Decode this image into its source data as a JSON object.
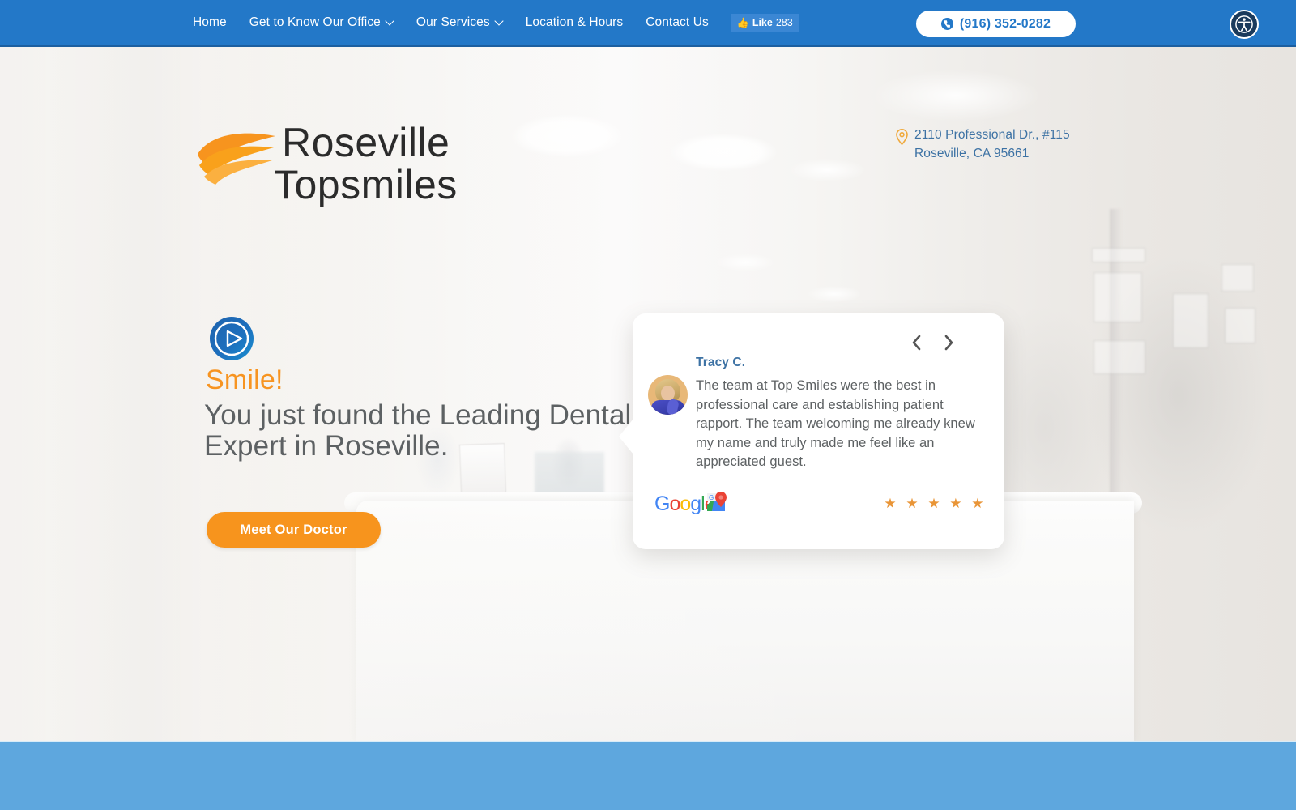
{
  "nav": {
    "items": [
      {
        "label": "Home",
        "has_caret": false
      },
      {
        "label": "Get to Know Our Office",
        "has_caret": true
      },
      {
        "label": "Our Services",
        "has_caret": true
      },
      {
        "label": "Location & Hours",
        "has_caret": false
      },
      {
        "label": "Contact Us",
        "has_caret": false
      }
    ],
    "like": {
      "icon": "thumbs-up-icon",
      "label": "Like",
      "count": "283"
    },
    "phone": {
      "icon": "phone-icon",
      "number": "(916) 352-0282"
    },
    "accessibility": {
      "icon": "accessibility-icon",
      "label": "Accessibility Menu"
    }
  },
  "brand": {
    "logo_icon": "flame-swoosh-logo",
    "line1": "Roseville",
    "line2": "Topsmiles"
  },
  "address": {
    "pin_icon": "location-pin-icon",
    "line1": "2110 Professional Dr., #115",
    "line2": "Roseville, CA 95661"
  },
  "hero": {
    "play_icon": "play-circle-icon",
    "eyebrow": "Smile!",
    "headline": "You just found the Leading Dental Care Expert in Roseville.",
    "cta_label": "Meet Our Doctor"
  },
  "testimonial": {
    "prev_icon": "chevron-left-icon",
    "next_icon": "chevron-right-icon",
    "avatar_icon": "reviewer-avatar",
    "author": "Tracy C.",
    "body": "The team at Top Smiles were the best in professional care and establishing patient rapport. The team welcoming me already knew my name and truly made me feel like an appreciated guest.",
    "source_name": "Google",
    "source_letters": [
      "G",
      "o",
      "o",
      "g",
      "l",
      "e"
    ],
    "source_icon": "google-maps-pin-icon",
    "stars": "★ ★ ★ ★ ★",
    "rating": "5"
  },
  "colors": {
    "nav_blue": "#2378c8",
    "accent_orange": "#f7941d",
    "link_blue": "#3d72a4",
    "body_gray": "#5d6163",
    "band_blue": "#5ea7de",
    "star_orange": "#e99537"
  }
}
